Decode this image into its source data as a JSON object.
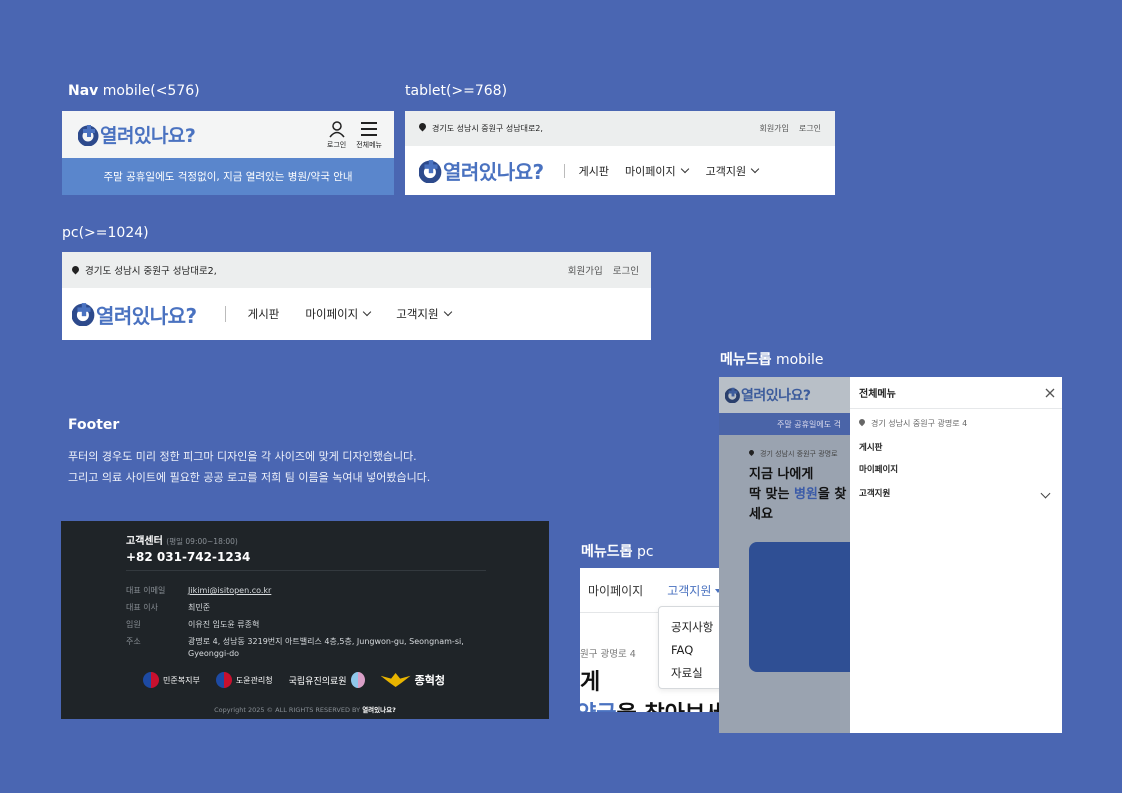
{
  "labels": {
    "nav_mobile_bold": "Nav",
    "nav_mobile": " mobile(<576)",
    "tablet": "tablet(>=768)",
    "pc": "pc(>=1024)",
    "menu_mobile_bold": "메뉴드롭",
    "menu_mobile": " mobile",
    "menu_pc_bold": "메뉴드롭",
    "menu_pc": " pc",
    "footer_title": "Footer",
    "footer_desc1": "푸터의 경우도 미리 정한 피그마 디자인을 각 사이즈에 맞게 디자인했습니다.",
    "footer_desc2": "그리고 의료 사이트에 필요한 공공 로고를 저희 팀 이름을 녹여내 넣어봤습니다."
  },
  "brand": {
    "logo_text": "열려있나요?",
    "accent": "#4a72c0",
    "background": "#4a66b2"
  },
  "mobile_nav": {
    "login": "로그인",
    "all_menu": "전체메뉴",
    "banner": "주말 공휴일에도 걱정없이, 지금 열려있는 병원/약국 안내"
  },
  "header": {
    "address": "경기도 성남시 중원구 성남대로2,",
    "signup": "회원가입",
    "login": "로그인",
    "nav": [
      "게시판",
      "마이페이지",
      "고객지원"
    ]
  },
  "footer": {
    "cs_title": "고객센터",
    "cs_hours": "(평일 09:00~18:00)",
    "phone": "+82 031-742-1234",
    "rows": [
      {
        "k": "대표 이메일",
        "v": "Jikimi@isitopen.co.kr"
      },
      {
        "k": "대표 이사",
        "v": "최민준"
      },
      {
        "k": "임원",
        "v": "이유진  임도윤  류종혁"
      },
      {
        "k": "주소",
        "v": "광명로 4, 성남동 3219번지 아트밸리스 4층,5층, Jungwon-gu, Seongnam-si, Gyeonggi-do"
      }
    ],
    "logos": [
      "민준복지부",
      "도윤관리청",
      "국립유진의료원",
      "종혁청"
    ],
    "copyright_prefix": "Copyright 2025 © ALL RIGHTS RESERVED BY ",
    "copyright_brand": "열려있나요?"
  },
  "menu_pc": {
    "tab_mypage": "마이페이지",
    "tab_support": "고객지원",
    "items": [
      "공지사항",
      "FAQ",
      "자료실"
    ],
    "bg_address": "원구 광명로 4",
    "bg_line1": "게",
    "bg_line2a": "약국",
    "bg_line2b": "을 찾아보세요"
  },
  "menu_mobile": {
    "title": "전체메뉴",
    "address": "경기 성남시 중원구 광명로 4",
    "items": [
      "게시판",
      "마이페이지",
      "고객지원"
    ],
    "bg_banner": "주말 공휴일에도 걱",
    "bg_address": "경기 성남시 중원구 광명로",
    "bg_line1": "지금 나에게",
    "bg_line2a": "딱 맞는 ",
    "bg_line2b": "병원",
    "bg_line2c": "을 찾",
    "bg_line3": "세요"
  }
}
